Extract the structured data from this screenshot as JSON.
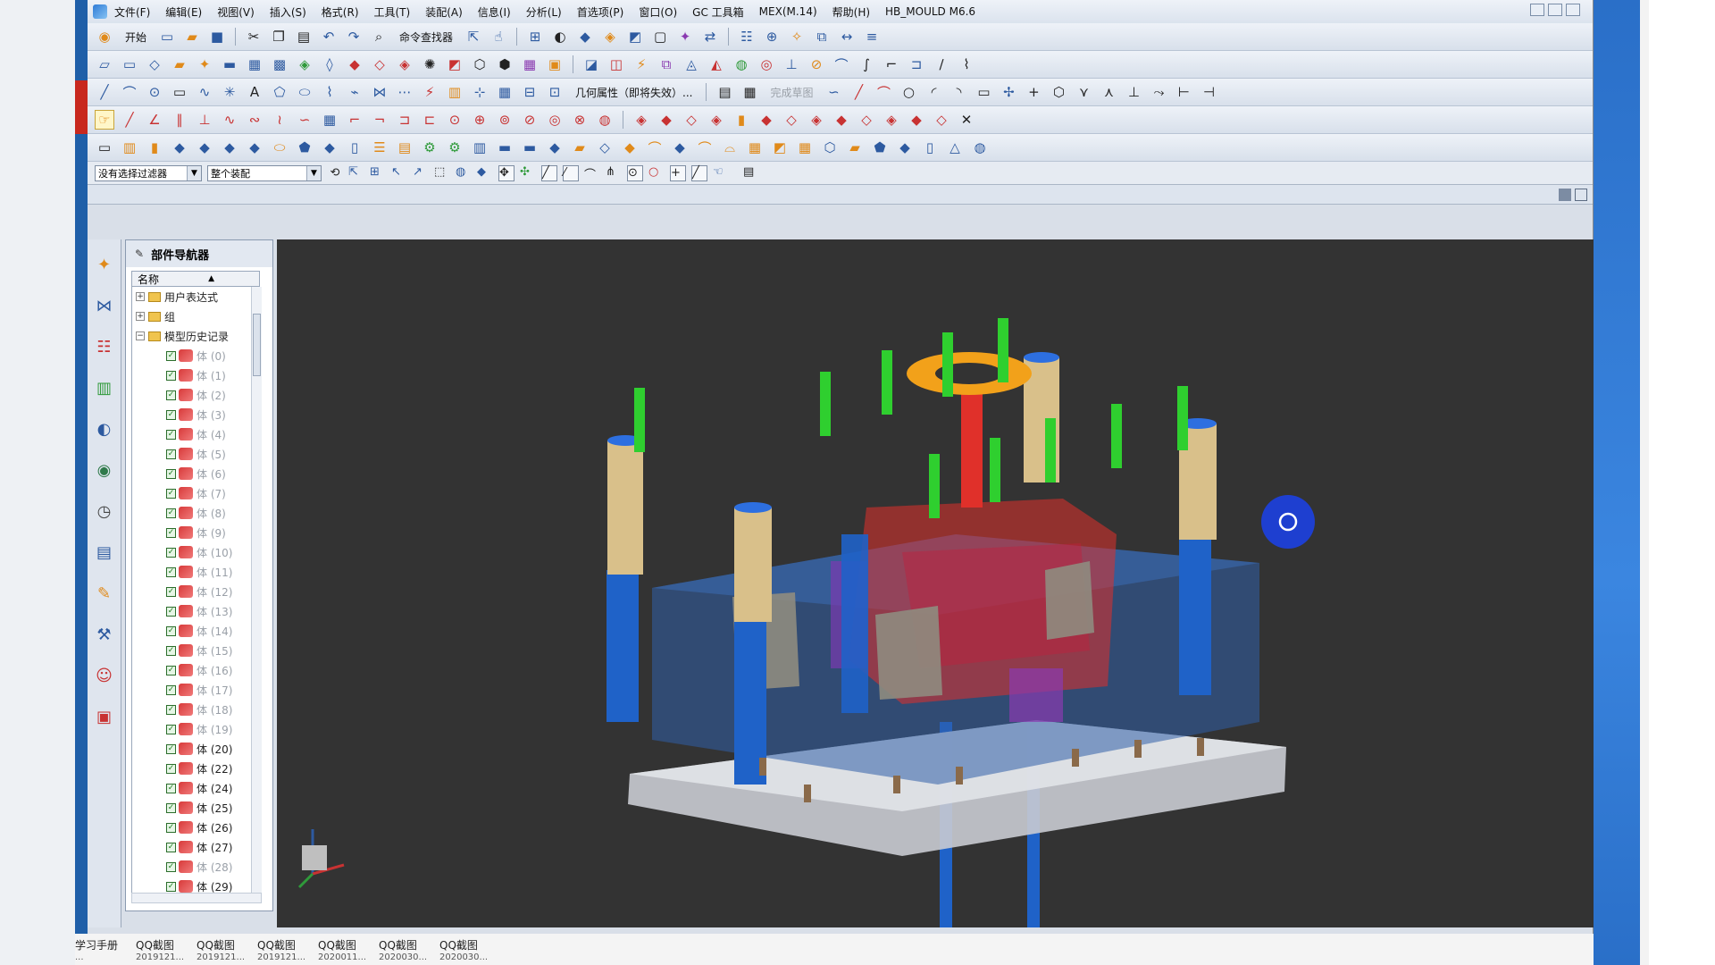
{
  "menu": {
    "items": [
      "文件(F)",
      "编辑(E)",
      "视图(V)",
      "插入(S)",
      "格式(R)",
      "工具(T)",
      "装配(A)",
      "信息(I)",
      "分析(L)",
      "首选项(P)",
      "窗口(O)",
      "GC 工具箱",
      "MEX(M.14)",
      "帮助(H)",
      "HB_MOULD M6.6"
    ]
  },
  "toolbar": {
    "start_label": "开始",
    "command_finder_label": "命令查找器",
    "geometry_property_label": "几何属性（即将失效）...",
    "complete_sketch_label": "完成草图"
  },
  "selection_bar": {
    "filter_value": "没有选择过滤器",
    "scope_value": "整个装配"
  },
  "navigator": {
    "title": "部件导航器",
    "column_name": "名称",
    "groups": [
      {
        "label": "用户表达式",
        "expander": "+"
      },
      {
        "label": "组",
        "expander": "+"
      },
      {
        "label": "模型历史记录",
        "expander": "−"
      }
    ],
    "features": [
      {
        "label": "体 (0)",
        "dim": true
      },
      {
        "label": "体 (1)",
        "dim": true
      },
      {
        "label": "体 (2)",
        "dim": true
      },
      {
        "label": "体 (3)",
        "dim": true
      },
      {
        "label": "体 (4)",
        "dim": true
      },
      {
        "label": "体 (5)",
        "dim": true
      },
      {
        "label": "体 (6)",
        "dim": true
      },
      {
        "label": "体 (7)",
        "dim": true
      },
      {
        "label": "体 (8)",
        "dim": true
      },
      {
        "label": "体 (9)",
        "dim": true
      },
      {
        "label": "体 (10)",
        "dim": true
      },
      {
        "label": "体 (11)",
        "dim": true
      },
      {
        "label": "体 (12)",
        "dim": true
      },
      {
        "label": "体 (13)",
        "dim": true
      },
      {
        "label": "体 (14)",
        "dim": true
      },
      {
        "label": "体 (15)",
        "dim": true
      },
      {
        "label": "体 (16)",
        "dim": true
      },
      {
        "label": "体 (17)",
        "dim": true
      },
      {
        "label": "体 (18)",
        "dim": true
      },
      {
        "label": "体 (19)",
        "dim": true
      },
      {
        "label": "体 (20)",
        "dim": false
      },
      {
        "label": "体 (22)",
        "dim": false
      },
      {
        "label": "体 (24)",
        "dim": false
      },
      {
        "label": "体 (25)",
        "dim": false
      },
      {
        "label": "体 (26)",
        "dim": false
      },
      {
        "label": "体 (27)",
        "dim": false
      },
      {
        "label": "体 (28)",
        "dim": true
      },
      {
        "label": "体 (29)",
        "dim": false
      }
    ]
  },
  "taskbar": {
    "items": [
      {
        "label": "学习手册",
        "sub": "..."
      },
      {
        "label": "QQ截图",
        "sub": "2019121..."
      },
      {
        "label": "QQ截图",
        "sub": "2019121..."
      },
      {
        "label": "QQ截图",
        "sub": "2019121..."
      },
      {
        "label": "QQ截图",
        "sub": "2020011..."
      },
      {
        "label": "QQ截图",
        "sub": "2020030..."
      },
      {
        "label": "QQ截图",
        "sub": "2020030..."
      }
    ]
  },
  "colors": {
    "viewport_bg": "#333333",
    "plate_blue": "#2f5fa8",
    "pillar_tan": "#d9c08a",
    "pin_green": "#2fcf2f",
    "ring_orange": "#f2a11a",
    "core_red": "#e0302a"
  }
}
